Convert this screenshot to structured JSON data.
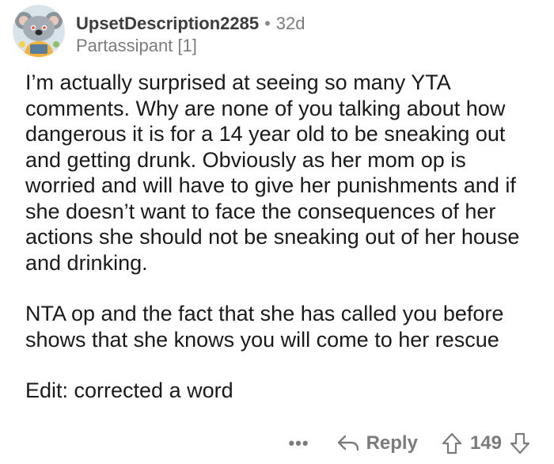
{
  "comment": {
    "username": "UpsetDescription2285",
    "separator": "•",
    "age": "32d",
    "flair": "Partassipant [1]",
    "paragraphs": [
      "I’m actually surprised at seeing so many YTA comments. Why are none of you talking about how dangerous it is for a 14 year old to be sneaking out and getting drunk. Obviously as her mom op is worried and will have to give her punishments and if she doesn’t want to face the consequences of her actions she should not be sneaking out of her house and drinking.",
      "NTA op and the fact that she has called you before shows that she knows you will come to her rescue",
      "Edit: corrected a word"
    ]
  },
  "actions": {
    "more_label": "•••",
    "reply_label": "Reply",
    "score": "149"
  },
  "icons": {
    "avatar": "snoo-koala-avatar",
    "reply": "reply-arrow-icon",
    "upvote": "upvote-arrow-icon",
    "downvote": "downvote-arrow-icon"
  },
  "colors": {
    "meta_gray": "#7c7c7c",
    "text": "#1a1a1b"
  }
}
